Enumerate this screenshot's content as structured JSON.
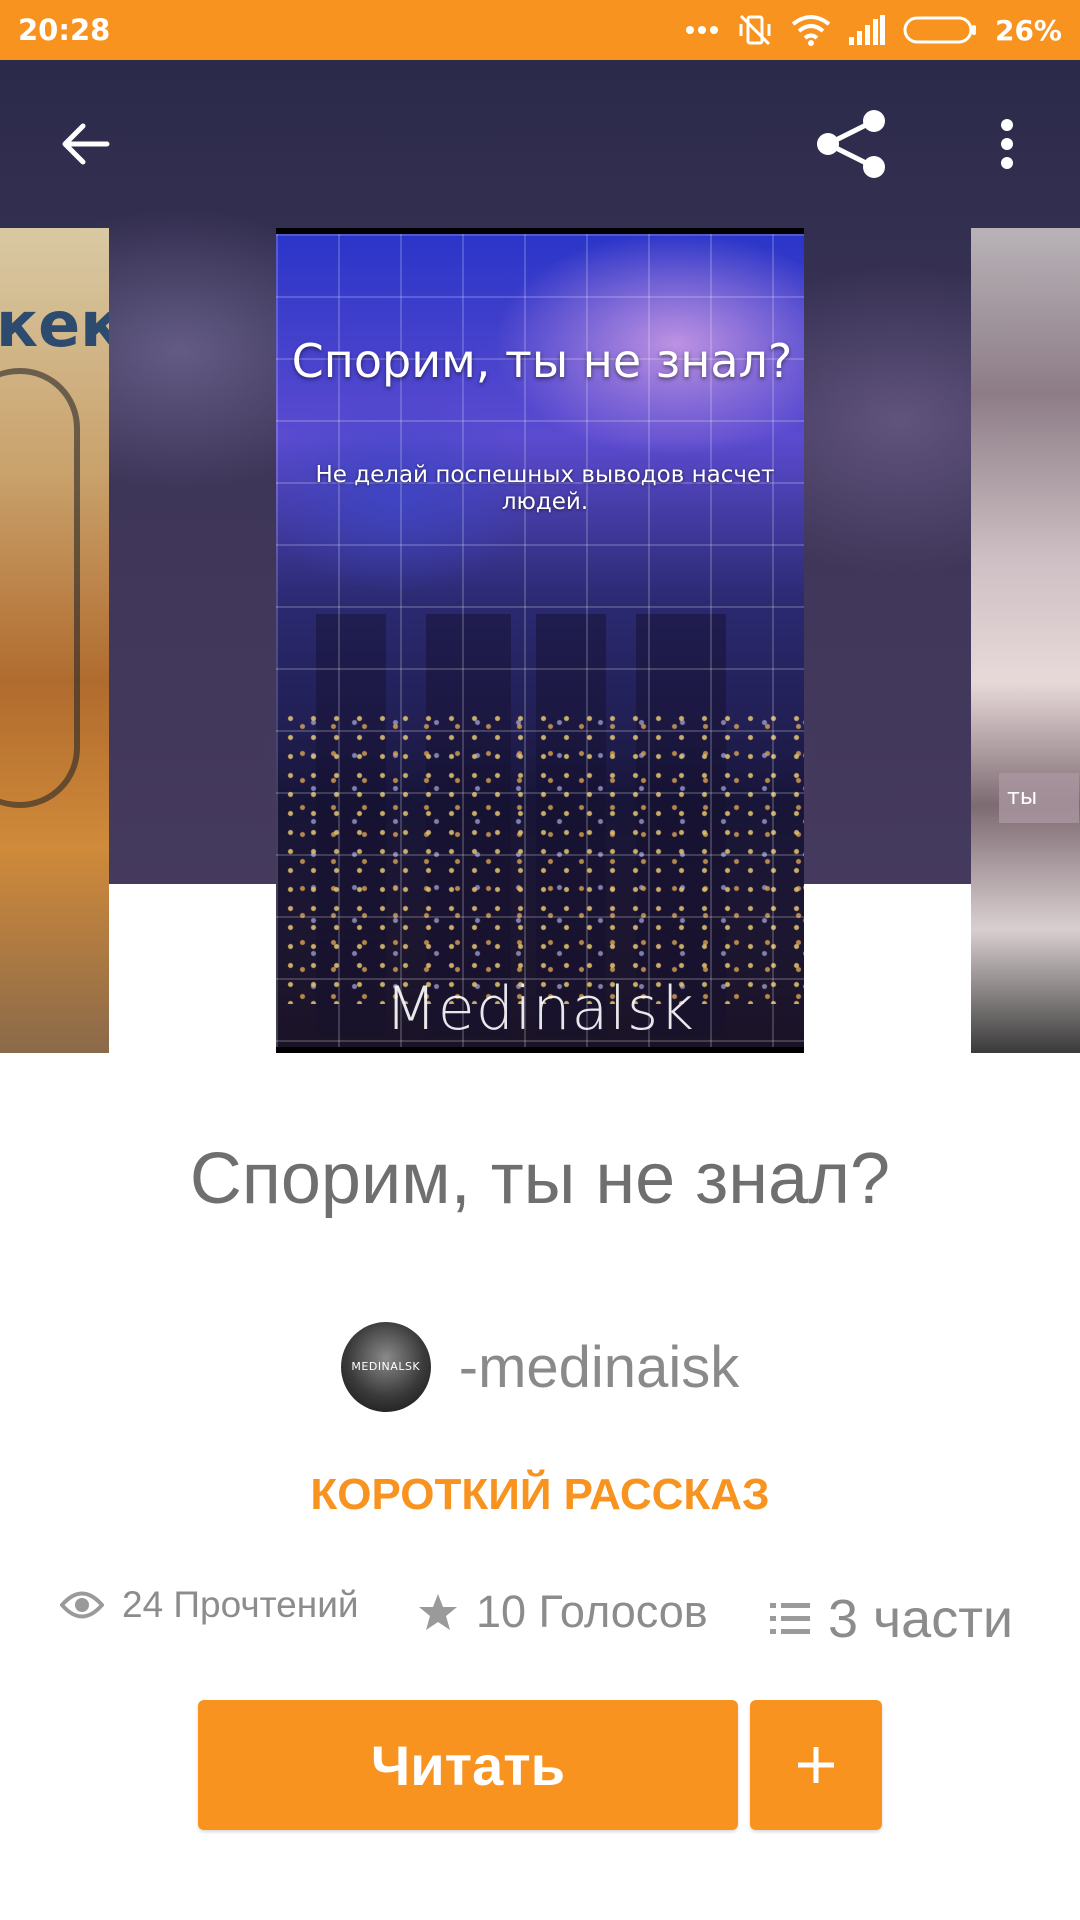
{
  "status_bar": {
    "time": "20:28",
    "battery": "26%",
    "background_color": "#f7931e",
    "icons": [
      "more-dots-icon",
      "vibrate-off-icon",
      "wifi-icon",
      "signal-icon",
      "battery-icon"
    ]
  },
  "top_bar": {
    "back_icon": "arrow-left-icon",
    "share_icon": "share-icon",
    "more_icon": "more-vertical-icon"
  },
  "cover": {
    "title": "Спорим, ты не знал?",
    "subtitle": "Не делай поспешных выводов насчет людей.",
    "author": "Medinalsk",
    "left_cover_text": "кек"
  },
  "right_cover_tag": "ты",
  "story": {
    "title": "Спорим, ты не знал?",
    "author_name": "-medinaisk",
    "avatar_text": "MEDINALSK",
    "genre": "КОРОТКИЙ РАССКАЗ",
    "accent_color": "#f7931e"
  },
  "stats": {
    "reads": "24 Прочтений",
    "votes": "10 Голосов",
    "parts": "3 части",
    "reads_icon": "eye-icon",
    "votes_icon": "star-icon",
    "parts_icon": "list-icon"
  },
  "actions": {
    "read_label": "Читать",
    "add_icon": "plus-icon"
  }
}
